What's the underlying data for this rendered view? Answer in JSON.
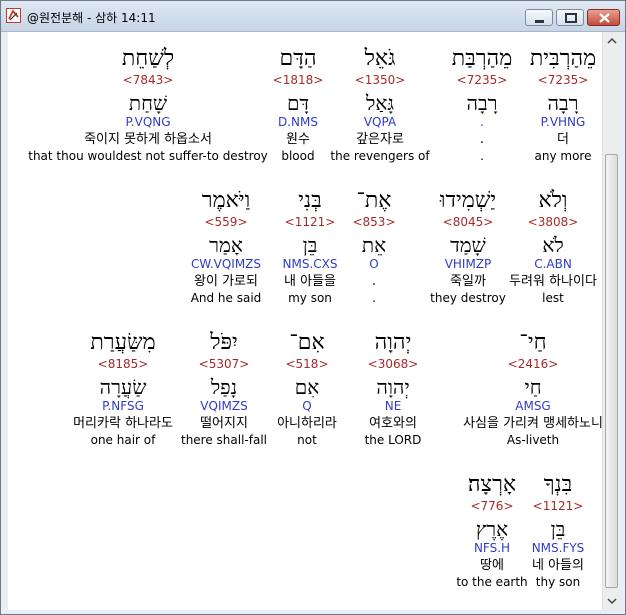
{
  "window": {
    "title": "@원전분해 - 삼하 14:11",
    "buttons": {
      "minimize": "minimize",
      "maximize": "maximize",
      "close": "close"
    }
  },
  "rows": [
    [
      {
        "heb": "מֵהַרְבִּית",
        "num": "<7235>",
        "lemma": "רָבָה",
        "parse": "P.VHNG",
        "ko": "더",
        "en": "any more"
      },
      {
        "heb": "מֵהַרְבַּת",
        "num": "<7235>",
        "lemma": "רָבָה",
        "parse": ".",
        "ko": ".",
        "en": "."
      },
      {
        "heb": "גֹּאֵל",
        "num": "<1350>",
        "lemma": "גָּאַל",
        "parse": "VQPA",
        "ko": "갚은자로",
        "en": "the revengers of"
      },
      {
        "heb": "הַדָּם",
        "num": "<1818>",
        "lemma": "דָּם",
        "parse": "D.NMS",
        "ko": "원수",
        "en": "blood"
      },
      {
        "heb": "לְשַׁחֵת",
        "num": "<7843>",
        "lemma": "שָׁחַת",
        "parse": "P.VQNG",
        "ko": "죽이지 못하게 하옵소서",
        "en": "that thou wouldest not suffer-to destroy"
      }
    ],
    [
      {
        "heb": "וְלֹא",
        "num": "<3808>",
        "lemma": "לֹא",
        "parse": "C.ABN",
        "ko": "두려워 하나이다",
        "en": "lest"
      },
      {
        "heb": "יַשְׁמִידוּ",
        "num": "<8045>",
        "lemma": "שָׁמַד",
        "parse": "VHIMZP",
        "ko": "죽일까",
        "en": "they destroy"
      },
      {
        "heb": "אֶת־",
        "num": "<853>",
        "lemma": "אֵת",
        "parse": "O",
        "ko": ".",
        "en": "."
      },
      {
        "heb": "בְּנִי",
        "num": "<1121>",
        "lemma": "בֵּן",
        "parse": "NMS.CXS",
        "ko": "내 아들을",
        "en": "my son"
      },
      {
        "heb": "וַיֹּאמֶר",
        "num": "<559>",
        "lemma": "אָמַר",
        "parse": "CW.VQIMZS",
        "ko": "왕이 가로되",
        "en": "And he said"
      }
    ],
    [
      {
        "heb": "חַי־",
        "num": "<2416>",
        "lemma": "חַי",
        "parse": "AMSG",
        "ko": "사심을 가리켜 맹세하노니",
        "en": "As-liveth"
      },
      {
        "heb": "יְהוָה",
        "num": "<3068>",
        "lemma": "יְהוָה",
        "parse": "NE",
        "ko": "여호와의",
        "en": "the LORD"
      },
      {
        "heb": "אִם־",
        "num": "<518>",
        "lemma": "אִם",
        "parse": "Q",
        "ko": "아니하리라",
        "en": "not"
      },
      {
        "heb": "יִפֹּל",
        "num": "<5307>",
        "lemma": "נָפַל",
        "parse": "VQIMZS",
        "ko": "떨어지지",
        "en": "there shall-fall"
      },
      {
        "heb": "מִשַּׂעֲרַת",
        "num": "<8185>",
        "lemma": "שַׂעֲרָה",
        "parse": "P.NFSG",
        "ko": "머리카락 하나라도",
        "en": "one hair of"
      }
    ],
    [
      {
        "heb": "בִּנְךָ",
        "num": "<1121>",
        "lemma": "בֵּן",
        "parse": "NMS.FYS",
        "ko": "네 아들의",
        "en": "thy son"
      },
      {
        "heb": "אָרְצָה׃",
        "num": "<776>",
        "lemma": "אֶרֶץ",
        "parse": "NFS.H",
        "ko": "땅에",
        "en": "to the earth"
      }
    ]
  ]
}
